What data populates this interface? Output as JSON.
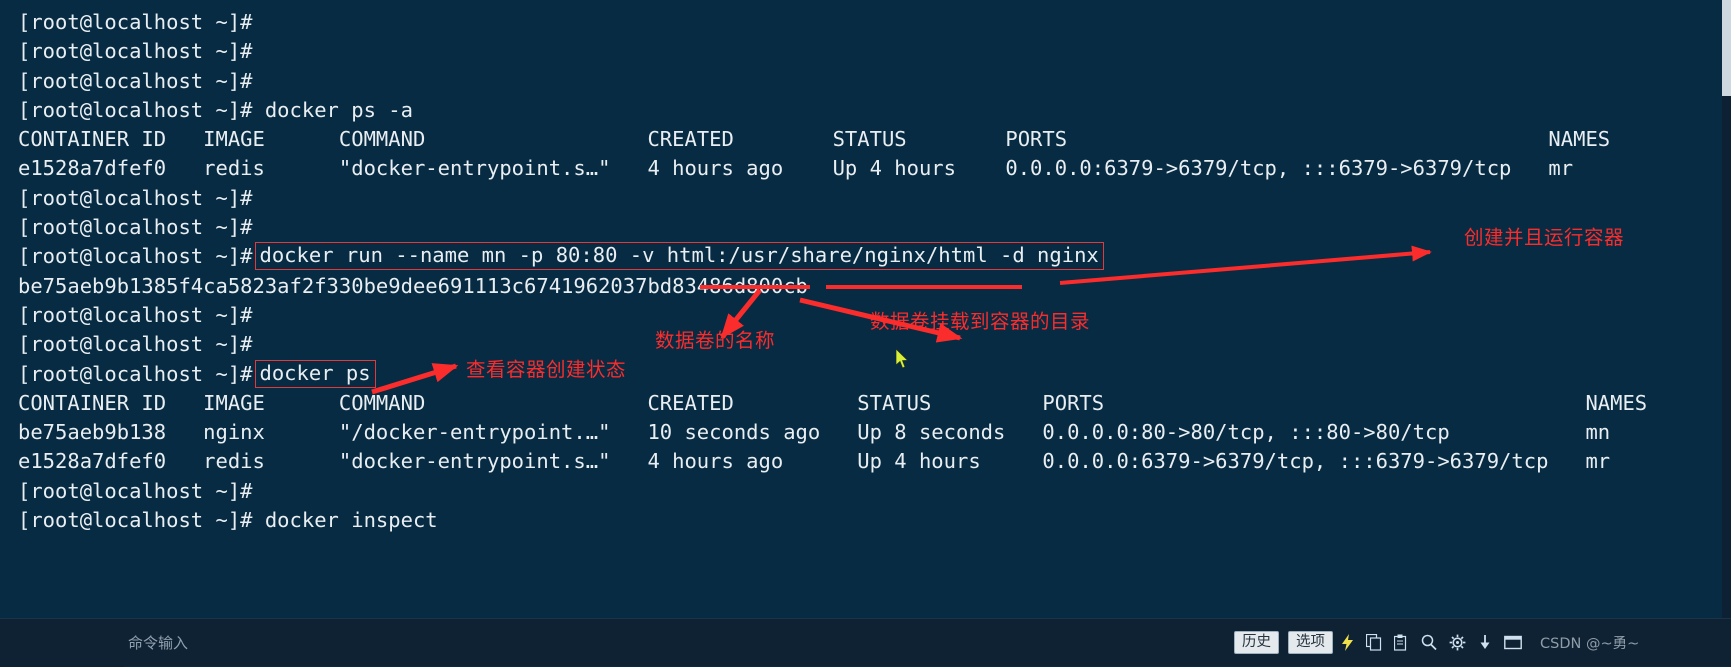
{
  "terminal": {
    "prompt": "[root@localhost ~]#",
    "lines": [
      {
        "type": "prompt",
        "cmd": ""
      },
      {
        "type": "prompt",
        "cmd": ""
      },
      {
        "type": "prompt",
        "cmd": ""
      },
      {
        "type": "prompt",
        "cmd": " docker ps -a"
      },
      {
        "type": "raw",
        "text": "CONTAINER ID   IMAGE      COMMAND                  CREATED        STATUS        PORTS                                       NAMES"
      },
      {
        "type": "raw",
        "text": "e1528a7dfef0   redis      \"docker-entrypoint.s…\"   4 hours ago    Up 4 hours    0.0.0.0:6379->6379/tcp, :::6379->6379/tcp   mr"
      },
      {
        "type": "prompt",
        "cmd": ""
      },
      {
        "type": "prompt",
        "cmd": ""
      },
      {
        "type": "prompt-boxed",
        "cmd": "docker run --name mn -p 80:80 -v html:/usr/share/nginx/html -d nginx"
      },
      {
        "type": "raw",
        "text": "be75aeb9b1385f4ca5823af2f330be9dee691113c6741962037bd83486d800cb"
      },
      {
        "type": "prompt",
        "cmd": ""
      },
      {
        "type": "prompt",
        "cmd": ""
      },
      {
        "type": "prompt-boxed",
        "cmd": "docker ps"
      },
      {
        "type": "raw",
        "text": "CONTAINER ID   IMAGE      COMMAND                  CREATED          STATUS         PORTS                                       NAMES"
      },
      {
        "type": "raw",
        "text": "be75aeb9b138   nginx      \"/docker-entrypoint.…\"   10 seconds ago   Up 8 seconds   0.0.0.0:80->80/tcp, :::80->80/tcp           mn"
      },
      {
        "type": "raw",
        "text": "e1528a7dfef0   redis      \"docker-entrypoint.s…\"   4 hours ago      Up 4 hours     0.0.0.0:6379->6379/tcp, :::6379->6379/tcp   mr"
      },
      {
        "type": "prompt",
        "cmd": ""
      },
      {
        "type": "prompt",
        "cmd": " docker inspect"
      }
    ],
    "ps_a_command": "docker ps -a",
    "run_command": "docker run --name mn -p 80:80 -v html:/usr/share/nginx/html -d nginx",
    "ps_command": "docker ps",
    "inspect_command": "docker inspect",
    "container_id_output": "be75aeb9b1385f4ca5823af2f330be9dee691113c6741962037bd83486d800cb",
    "table_headers": [
      "CONTAINER ID",
      "IMAGE",
      "COMMAND",
      "CREATED",
      "STATUS",
      "PORTS",
      "NAMES"
    ],
    "ps_a_rows": [
      [
        "e1528a7dfef0",
        "redis",
        "\"docker-entrypoint.s…\"",
        "4 hours ago",
        "Up 4 hours",
        "0.0.0.0:6379->6379/tcp, :::6379->6379/tcp",
        "mr"
      ]
    ],
    "ps_rows": [
      [
        "be75aeb9b138",
        "nginx",
        "\"/docker-entrypoint.…\"",
        "10 seconds ago",
        "Up 8 seconds",
        "0.0.0.0:80->80/tcp, :::80->80/tcp",
        "mn"
      ],
      [
        "e1528a7dfef0",
        "redis",
        "\"docker-entrypoint.s…\"",
        "4 hours ago",
        "Up 4 hours",
        "0.0.0.0:6379->6379/tcp, :::6379->6379/tcp",
        "mr"
      ]
    ]
  },
  "annotations": {
    "create_and_run": "创建并且运行容器",
    "volume_name": "数据卷的名称",
    "mount_dir": "数据卷挂载到容器的目录",
    "check_status": "查看容器创建状态",
    "color": "#fb2c2c"
  },
  "statusbar": {
    "input_placeholder": "命令输入",
    "input_value": "",
    "history_label": "历史",
    "options_label": "选项",
    "icons": [
      {
        "name": "lightning-icon",
        "glyph": "⚡"
      },
      {
        "name": "copy-icon",
        "glyph": "⎘"
      },
      {
        "name": "paste-icon",
        "glyph": "🗇"
      },
      {
        "name": "search-icon",
        "glyph": "🔍"
      },
      {
        "name": "gear-icon",
        "glyph": "⚙"
      },
      {
        "name": "download-icon",
        "glyph": "⬇"
      },
      {
        "name": "window-icon",
        "glyph": "▭"
      }
    ],
    "watermark": "CSDN @~勇~"
  },
  "theme": {
    "terminal_bg": "#072b42",
    "terminal_fg": "#e8eef2",
    "statusbar_bg": "#0f2234",
    "annotation_red": "#fb2c2c",
    "box_border": "#e03a3a"
  }
}
